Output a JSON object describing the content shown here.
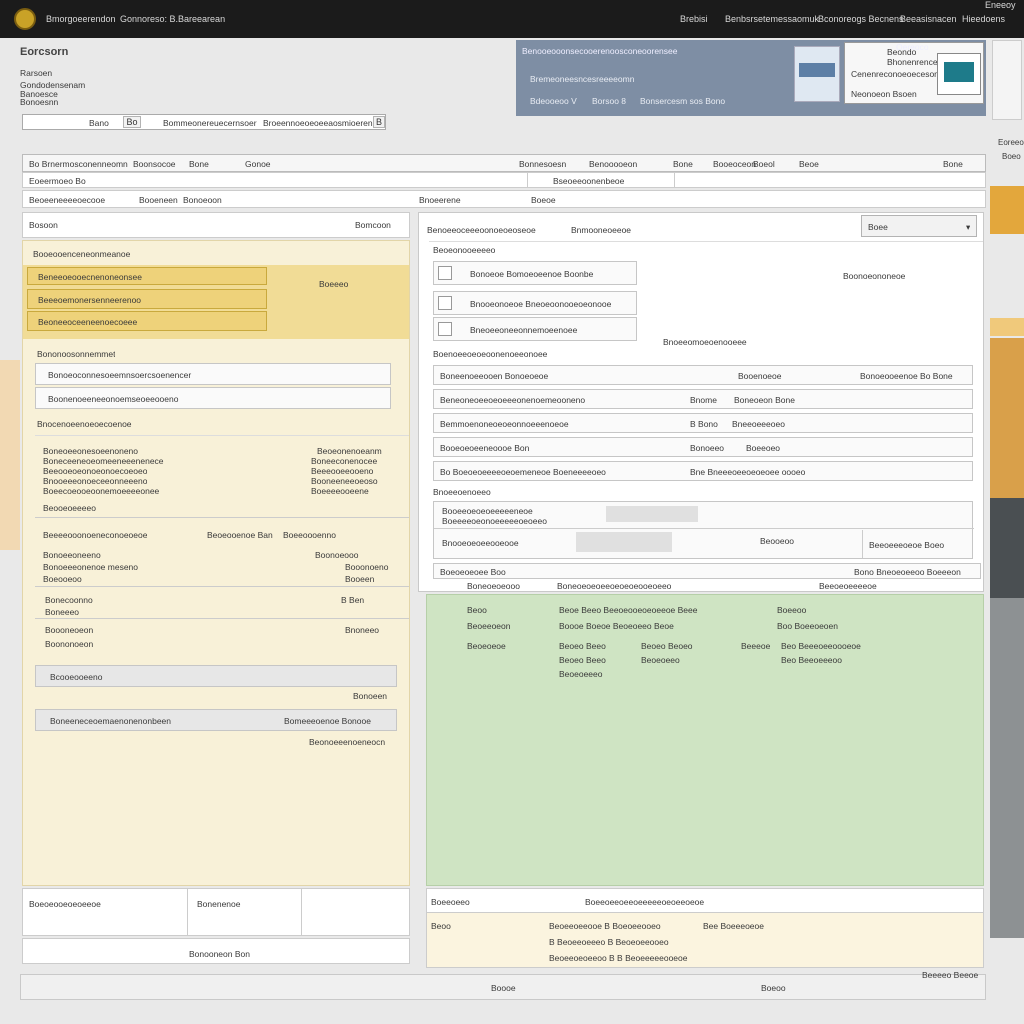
{
  "topbar": {
    "app_title": "Bmorgoeerendon",
    "subtitle": "Gonnoreso: B.Bareearean",
    "menu": [
      "Brebisi",
      "Benbsrsetemessaomuk",
      "Bconoreogs Becnens",
      "Beeasisnacen",
      "Hieedoens"
    ],
    "corner": "Eneeoy"
  },
  "header": {
    "brand": "Eorcsorn",
    "lines": [
      "Rarsoen",
      "Gondodensenam",
      "Banoesce",
      "Bonoesnn"
    ],
    "filter": {
      "value": "Bano",
      "mid": "Bo",
      "select": "Bommeonereuecernsoer",
      "field": "Broeennoeoeoeeaosmioerenere",
      "action": "B"
    }
  },
  "banner": {
    "title": "Benooeooonsecooerenoosconeoorensee",
    "line2": "Bremeoneesncesreeeeomn",
    "line3": [
      "Bdeooeoo V",
      "Borsoo 8",
      "Bonsercesm sos Bono"
    ],
    "card_label": "Oereoco",
    "card_lines": [
      "Beondo",
      "Bhonenrenceenene",
      "Cenenreconoeoeceson",
      "Neonoeon Bsoen"
    ]
  },
  "grid": {
    "columns": [
      "Bo Brnermosconenneomn",
      "Boonsocoe",
      "Bone",
      "Gonoe",
      "Bonnesoesn",
      "Benooooeon",
      "Bone",
      "Booeoceon",
      "Boeol",
      "Beoe"
    ],
    "corner": "Bone",
    "sub1": "Eoeermoeo Bo",
    "sub2": "Bseoeeoonenbeoe",
    "tabs": [
      "Beoeeneeeeoecooe",
      "Booeneen",
      "Bonoeoon",
      "Bnoeerene",
      "Boeoe"
    ]
  },
  "left": {
    "heading": "Bosoon",
    "heading_right": "Bomcoon",
    "section": "Booeooenceneonmeanoe",
    "gold_items": [
      "Beneeoeooecnenoneonsee",
      "Beeeoemonersenneerenoo",
      "Beoneeoceeneenoecoeee"
    ],
    "gold_side": "Boeeeo",
    "list_title": "Bononoosonnemmet",
    "boxes": [
      "Bonoeoconnesoeemnsoercsoenencer",
      "Boonenoeeneeonoemseoeeooeno"
    ],
    "section2": "Bnocenoeenoeoecoenoe",
    "detail_rows": [
      {
        "a": "Boneoeeonesoeenoneno",
        "b": "Beoeonenoeanm"
      },
      {
        "a": "Boneceeneoeomeeneeenenece",
        "b": "Boneeconenocee"
      },
      {
        "a": "Beeooeoeonoeonoecoeoeo",
        "b": "Beeeooeeooeno"
      },
      {
        "a": "Bnooeeeonoeceeonneeeno",
        "b": "Booneeneeoeoso"
      },
      {
        "a": "Boeecoeooeoonemoeeeeonee",
        "b": "Boeeeeooeene"
      }
    ],
    "sub_heading": "Beooeoeeeeo",
    "mid_rows": [
      {
        "a": "Beeeeooonoeneconoeoeoe",
        "b": "Beoeooenoe Ban",
        "c": "Boeeoooenno"
      },
      {
        "a": "Bonoeeoneeno",
        "c": "Boonoeooo"
      },
      {
        "a": "Bonoeeeonenoe meseno",
        "c": "Booonoeno"
      },
      {
        "a": "Boeooeoo",
        "c": "Booeen"
      }
    ],
    "pair1": {
      "a": "Bonecoonno",
      "b": "Boneeeo",
      "c": "B Ben"
    },
    "pair2": {
      "a": "Boooneoeon",
      "c": "Bnoneeo"
    },
    "pair3": {
      "a": "Boononoeon"
    },
    "bar1": "Bcooeooeeno",
    "bar1_note": "Bonoeen",
    "bar2": "Boneeneceoemaenonenonbeen",
    "bar2_right": "Bomeeeoenoe Bonooe",
    "bar2_note": "Beonoeeenoeneocn",
    "foot": {
      "a": "Boeoeooeoeoeeoe",
      "b": "Bonenenoe",
      "c": "Bonooneon Bon"
    }
  },
  "right": {
    "heading": "Benoeeoceeeoonoeoeoseoe",
    "heading2": "Bnmooneoeeoe",
    "select": "Boee",
    "section": "Beoeonooeeeeo",
    "choices": [
      "Bonoeoe Bomoeoeenoe Boonbe",
      "Bnooeonoeoe Bneoeoonooeoeonooe",
      "Bneoeeoneeonnemoeenoee"
    ],
    "side_note": "Boonoeononeoe",
    "side_note2": "Bnoeeomoeoenooeee",
    "label": "Boenoeeoeoeoonenoeeonoee",
    "rows": [
      {
        "a": "Boneenoeeooen Bonoeoeoe",
        "b": "Booenoeoe",
        "c": "Bonoeooeenoe Bo Bone"
      },
      {
        "a": "Beneoneoeeoeoeeeonenoemeooneno",
        "b": "Bnome",
        "c": "Boneoeon Bone"
      },
      {
        "a": "Bemmoenoneoeoeonnoeeenoeoe",
        "b": "B Bono",
        "c": "Bneeoeeeoeo"
      },
      {
        "a": "Booeoeoeeneoooe Bon",
        "b": "Bonoeeo",
        "c": "Boeeoeo"
      },
      {
        "a": "Bo Boeoeoeeeeoeoemeneoe Boeneeeeoeo",
        "b": "Bne Bneeeoeeoeoeoee oooeo"
      }
    ],
    "group_label": "Bnoeeoenoeeo",
    "group_rows": [
      {
        "a": "Booeeoeoeoeeeeeneoe"
      },
      {
        "a": "Boeeeeoeonoeeeeeoeoeeo"
      },
      {
        "a": "Bnooeoeoeeooeooe",
        "b": "Beooeoo",
        "c": "Beeoeeeoeoe Boeo"
      }
    ],
    "footer_row": {
      "a": "Boeoeoeoee Boo",
      "b": "Boneoeoeoeeoeoeoeooeoeeo",
      "c": "Bono Bneoeoeeoo Boeeeon"
    },
    "footer_row2": {
      "a": "Boneoeoeooo",
      "b": "Beeoeoeeeeoe"
    }
  },
  "green": {
    "rows": [
      [
        "Beoo",
        "Beoe Beeo Beeoeooeoeoeeoe Beee",
        "Boeeoo"
      ],
      [
        "Beoeeoeon",
        "Boooe Boeoe Beoeoeeo Beoe",
        "Boo Boeeoeoen"
      ],
      [
        "Beoeoeoe",
        "Beoeo Beeo",
        "Beoeo Beoeo",
        "Beeeoe",
        "Beo Beeeoeeoooeoe"
      ],
      [
        "",
        "Beoeo Beeo",
        "Beoeoeeo",
        "",
        "Beo Beeoeeeoo"
      ],
      [
        "",
        "Beoeoeeeo"
      ]
    ]
  },
  "bottom_right": {
    "label": "Boeeoeeo",
    "field": "Boeeoeeoeeoeeeeeoeoeeoeoe",
    "line_a": "Beoo",
    "line_b": "Beoeeoeeooe B Boeoeeooeo",
    "line_c": "Bee Boeeeoeoe",
    "line_d": "B Beoeeoeeeo B Beoeoeeooeo",
    "line_e": "Beoeeoeoeeoo B B Beoeeeeeooeoe",
    "status": "Boooe",
    "status_right": "Boeoo",
    "corner": "Beeeeo Beeoe"
  },
  "right_rail": {
    "header": "Eoreeoo",
    "sub": "Boeo",
    "accent1": "#e3a73c",
    "accent2": "#d9a04a",
    "dark": "#4a4f52"
  },
  "colors": {
    "topbar": "#1b1b1b",
    "banner": "#7e8ea4",
    "yellow_panel": "#f8f1d8",
    "green_panel": "#cfe4c3",
    "gold": "#eed27a"
  }
}
